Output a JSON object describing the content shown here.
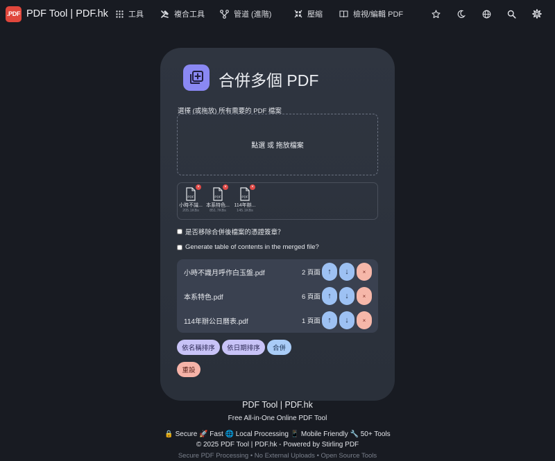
{
  "nav": {
    "logo_text": ".PDF",
    "brand": "PDF Tool | PDF.hk",
    "items": [
      {
        "label": "工具",
        "icon": "grid-icon"
      },
      {
        "label": "複合工具",
        "icon": "tools-icon"
      },
      {
        "label": "管道 (進階)",
        "icon": "pipeline-icon"
      },
      {
        "label": "壓縮",
        "icon": "compress-icon"
      },
      {
        "label": "檢視/編輯 PDF",
        "icon": "book-icon"
      }
    ],
    "right_icons": [
      "star-icon",
      "moon-icon",
      "globe-icon",
      "search-icon",
      "gear-icon"
    ]
  },
  "card": {
    "title": "合併多個 PDF",
    "icon": "merge-icon",
    "select_label": "選擇 (或拖放) 所有需要的 PDF 檔案",
    "dropzone_text": "點選 或 拖放檔案",
    "thumbnails": [
      {
        "name": "小時不識...",
        "size": "205.1KBs"
      },
      {
        "name": "本系特色...",
        "size": "851.7KBs"
      },
      {
        "name": "114年辦...",
        "size": "145.1KBs"
      }
    ],
    "thumb_type_label": "PDF",
    "checkbox_remove_signatures": "是否移除合併後檔案的憑證簽章？",
    "checkbox_toc": "Generate table of contents in the merged file?",
    "files": [
      {
        "name": "小時不識月呼作白玉盤.pdf",
        "pages": "2 頁面"
      },
      {
        "name": "本系特色.pdf",
        "pages": "6 頁面"
      },
      {
        "name": "114年辦公日曆表.pdf",
        "pages": "1 頁面"
      }
    ],
    "move_up_label": "↑",
    "move_down_label": "↓",
    "remove_label": "×",
    "sort_by_name": "依名稱排序",
    "sort_by_date": "依日期排序",
    "merge_button": "合併",
    "reset_button": "重設"
  },
  "footer": {
    "title": "PDF Tool | PDF.hk",
    "subtitle": "Free All-in-One Online PDF Tool",
    "features": "🔒 Secure 🚀 Fast 🌐 Local Processing 📱 Mobile Friendly 🔧 50+ Tools",
    "copyright": "© 2025 PDF Tool | PDF.hk - Powered by Stirling PDF",
    "tagline": "Secure PDF Processing • No External Uploads • Open Source Tools"
  },
  "colors": {
    "background": "#181b22",
    "card": "#2f3540",
    "logo": "#e0473c",
    "accent_violet": "#8a88f3",
    "button_blue": "#9dc1f3",
    "button_salmon": "#f6b7a9"
  }
}
